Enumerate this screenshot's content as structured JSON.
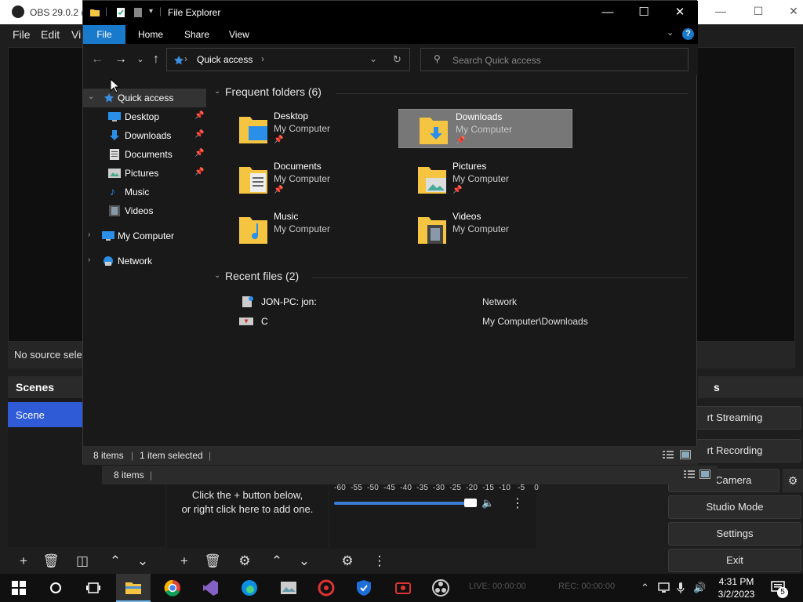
{
  "obs": {
    "title": "OBS 29.0.2 (6",
    "menu": [
      "File",
      "Edit",
      "Vi"
    ],
    "no_source": "No source sele",
    "scenes_title": "Scenes",
    "scene_item": "Scene",
    "sources_hint_1": "Click the + button below,",
    "sources_hint_2": "or right click here to add one.",
    "mixer_ticks": "-60  -55  -50  -45  -40  -35  -30  -25  -20  -15  -10   -5    0",
    "controls_title": "s",
    "controls": {
      "streaming": "rt Streaming",
      "recording": "rt Recording",
      "virtual_camera": "tual Camera",
      "studio_mode": "Studio Mode",
      "settings": "Settings",
      "exit": "Exit"
    }
  },
  "explorer": {
    "title": "File Explorer",
    "ribbon": {
      "file": "File",
      "home": "Home",
      "share": "Share",
      "view": "View",
      "help": "?"
    },
    "address": {
      "crumb": "Quick access"
    },
    "search": {
      "placeholder": "Search Quick access"
    },
    "nav": {
      "quick_access": "Quick access",
      "items": [
        {
          "label": "Desktop",
          "pinned": true
        },
        {
          "label": "Downloads",
          "pinned": true
        },
        {
          "label": "Documents",
          "pinned": true
        },
        {
          "label": "Pictures",
          "pinned": true
        },
        {
          "label": "Music",
          "pinned": false
        },
        {
          "label": "Videos",
          "pinned": false
        }
      ],
      "my_computer": "My Computer",
      "network": "Network"
    },
    "frequent": {
      "header": "Frequent folders (6)",
      "folders": [
        {
          "name": "Desktop",
          "location": "My Computer",
          "pinned": true
        },
        {
          "name": "Downloads",
          "location": "My Computer",
          "pinned": true,
          "selected": true
        },
        {
          "name": "Documents",
          "location": "My Computer",
          "pinned": true
        },
        {
          "name": "Pictures",
          "location": "My Computer",
          "pinned": true
        },
        {
          "name": "Music",
          "location": "My Computer",
          "pinned": false
        },
        {
          "name": "Videos",
          "location": "My Computer",
          "pinned": false
        }
      ]
    },
    "recent": {
      "header": "Recent files (2)",
      "files": [
        {
          "name": "JON-PC: jon:",
          "location": "Network"
        },
        {
          "name": "C",
          "location": "My Computer\\Downloads"
        }
      ]
    },
    "status": {
      "count": "8 items",
      "selected": "1 item selected"
    },
    "status_behind": {
      "count": "8 items"
    }
  },
  "taskbar": {
    "time": "4:31 PM",
    "date": "3/2/2023",
    "live": "LIVE: 00:00:00",
    "rec": "REC: 00:00:00",
    "notification_count": "5"
  },
  "colors": {
    "accent": "#1979ca",
    "scene_selected": "#2f5bd6",
    "folder": "#f5c542"
  }
}
